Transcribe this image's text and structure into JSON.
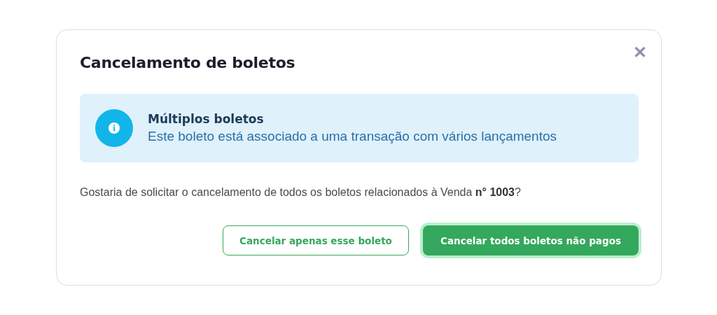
{
  "dialog": {
    "title": "Cancelamento de boletos",
    "close_label": "✕"
  },
  "alert": {
    "title": "Múltiplos boletos",
    "message": "Este boleto está associado a uma transação com vários lançamentos",
    "icon_text": "i"
  },
  "question": "Gostaria de solicitar o cancelamento de todos os boletos relacionados à Venda **n° 1003**?",
  "buttons": [
    {
      "label": "Cancelar apenas esse boleto",
      "kind": "secondary",
      "focused": false
    },
    {
      "label": "Cancelar todos boletos não pagos",
      "kind": "primary",
      "focused": true
    }
  ]
}
